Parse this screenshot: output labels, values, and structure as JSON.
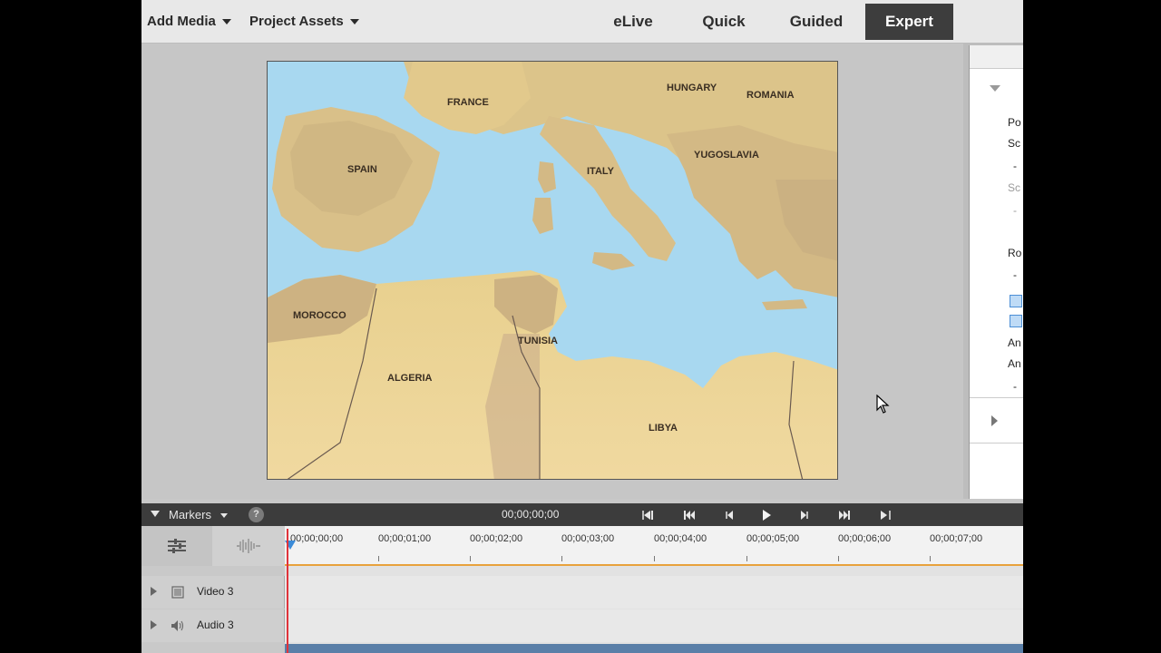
{
  "topbar": {
    "add_media": "Add Media",
    "project_assets": "Project Assets",
    "modes": [
      "eLive",
      "Quick",
      "Guided",
      "Expert"
    ],
    "active_mode": "Expert"
  },
  "map": {
    "labels": [
      "FRANCE",
      "SPAIN",
      "ITALY",
      "YUGOSLAVIA",
      "ROMANIA",
      "HUNGARY",
      "MOROCCO",
      "ALGERIA",
      "TUNISIA",
      "LIBYA"
    ],
    "colors": {
      "sea": "#a8d8f0",
      "land": "#e6cf8e",
      "mountains": "#b8a088",
      "desert": "#ecd49a"
    }
  },
  "right_panel": {
    "labels": [
      "Po",
      "Sc",
      "-",
      "Sc",
      "-",
      "Ro",
      "-",
      "An",
      "An",
      "-"
    ]
  },
  "timeline": {
    "markers_label": "Markers",
    "help_icon": "?",
    "current_time": "00;00;00;00",
    "ruler": [
      "00;00;00;00",
      "00;00;01;00",
      "00;00;02;00",
      "00;00;03;00",
      "00;00;04;00",
      "00;00;05;00",
      "00;00;06;00",
      "00;00;07;00"
    ],
    "tracks": [
      {
        "name": "Video 3",
        "icon": "film-icon"
      },
      {
        "name": "Audio 3",
        "icon": "speaker-icon"
      }
    ],
    "transport_icons": [
      "go-to-in-icon",
      "previous-edit-icon",
      "step-back-icon",
      "play-icon",
      "step-forward-icon",
      "next-edit-icon",
      "go-to-out-icon"
    ]
  },
  "colors": {
    "accent_dark": "#3d3d3d",
    "playhead": "#e0333b",
    "work_area": "#e8a23c"
  }
}
